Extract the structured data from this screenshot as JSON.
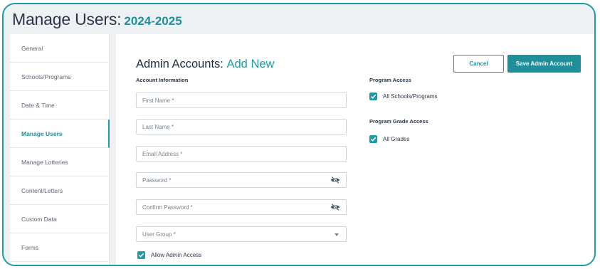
{
  "header": {
    "title": "Manage Users:",
    "year": "2024-2025"
  },
  "sidebar": {
    "items": [
      {
        "label": "General"
      },
      {
        "label": "Schools/Programs"
      },
      {
        "label": "Date & Time"
      },
      {
        "label": "Manage Users",
        "active": true
      },
      {
        "label": "Manage Lotteries"
      },
      {
        "label": "Content/Letters"
      },
      {
        "label": "Custom Data"
      },
      {
        "label": "Forms"
      }
    ]
  },
  "main": {
    "heading": {
      "part1": "Admin Accounts:",
      "part2": "Add New"
    },
    "account_info_label": "Account Information",
    "fields": {
      "first_name": {
        "placeholder": "First Name *"
      },
      "last_name": {
        "placeholder": "Last Name *"
      },
      "email": {
        "placeholder": "Email Address *"
      },
      "password": {
        "placeholder": "Password *",
        "icon": "eye-off-icon"
      },
      "confirm_password": {
        "placeholder": "Confirm Password *",
        "icon": "eye-off-icon"
      },
      "user_group": {
        "placeholder": "User Group *"
      }
    },
    "allow_admin_access": {
      "label": "Allow Admin Access",
      "checked": true
    },
    "program_access": {
      "label": "Program Access",
      "option": "All Schools/Programs",
      "checked": true
    },
    "program_grade_access": {
      "label": "Program Grade Access",
      "option": "All Grades",
      "checked": true
    },
    "buttons": {
      "cancel": "Cancel",
      "save": "Save Admin Account"
    }
  },
  "colors": {
    "accent": "#1f9aa6",
    "accent_dark": "#1f8f9a",
    "background": "#eef1f4",
    "text": "#1f2d3d"
  }
}
